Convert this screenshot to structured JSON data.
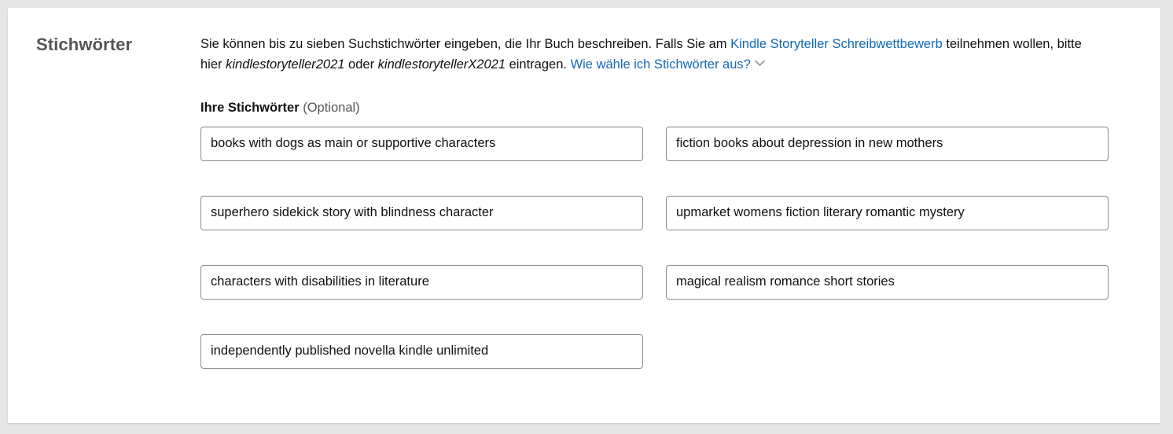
{
  "section": {
    "title": "Stichwörter",
    "description": {
      "part1": "Sie können bis zu sieben Suchstichwörter eingeben, die Ihr Buch beschreiben. Falls Sie am ",
      "link1": "Kindle Storyteller Schreibwettbewerb",
      "part2": " teilnehmen wollen, bitte hier ",
      "italic1": "kindlestoryteller2021",
      "part3": " oder ",
      "italic2": "kindlestorytellerX2021",
      "part4": " eintragen. ",
      "link2": "Wie wähle ich Stichwörter aus?",
      "chevron_icon": "chevron-down-icon"
    },
    "subhead": {
      "label": "Ihre Stichwörter",
      "optional": " (Optional)"
    },
    "keywords": [
      {
        "value": "books with dogs as main or supportive characters",
        "placeholder": ""
      },
      {
        "value": "fiction books about depression in new mothers",
        "placeholder": ""
      },
      {
        "value": "superhero sidekick story with blindness character",
        "placeholder": ""
      },
      {
        "value": "upmarket womens fiction literary romantic mystery",
        "placeholder": ""
      },
      {
        "value": "characters with disabilities in literature",
        "placeholder": ""
      },
      {
        "value": "magical realism romance short stories",
        "placeholder": ""
      },
      {
        "value": "independently published novella kindle unlimited",
        "placeholder": ""
      }
    ]
  },
  "colors": {
    "link": "#1169b8",
    "heading": "#555555",
    "text": "#111111",
    "input_border": "#888c8c",
    "page_background": "#e7e7e7",
    "card_background": "#ffffff"
  }
}
